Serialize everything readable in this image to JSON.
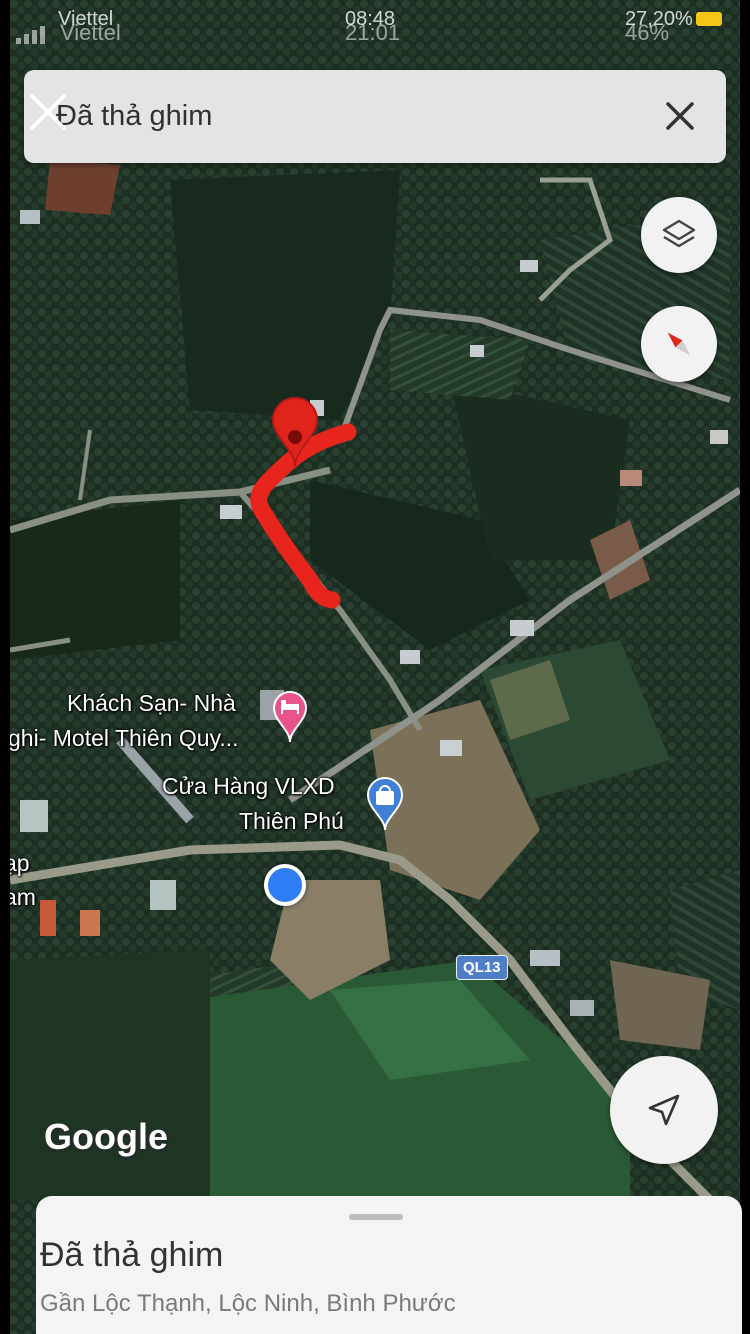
{
  "status_bar": {
    "carrier": "Viettel",
    "time": "21:01",
    "battery": "46%",
    "ghost_time": "08:48",
    "ghost_battery": "27,20%",
    "ghost_carrier": "Viettel"
  },
  "search_bar": {
    "title": "Đã thả ghim",
    "close_icon": "close-icon"
  },
  "map": {
    "poi_hotel": {
      "line1": "Khách Sạn- Nhà",
      "line2": "ghi- Motel Thiên Quy...",
      "icon": "hotel-pin-icon",
      "color": "#e8538c"
    },
    "poi_store": {
      "line1": "Cửa Hàng VLXD",
      "line2": "Thiên Phú",
      "icon": "shopping-pin-icon",
      "color": "#3f7fd6"
    },
    "left_edge_label": {
      "line1": "ạp",
      "line2": "am"
    },
    "road_badge": "QL13",
    "google_logo": "Google",
    "pin_color": "#e0241b",
    "route_color": "#e8251c",
    "location_dot_color": "#2f7df5"
  },
  "controls": {
    "layers_icon": "layers-icon",
    "compass_icon": "compass-icon",
    "navigate_icon": "navigate-arrow-icon"
  },
  "bottom_sheet": {
    "title": "Đã thả ghim",
    "subtitle": "Gần Lộc Thạnh, Lộc Ninh, Bình Phước"
  }
}
